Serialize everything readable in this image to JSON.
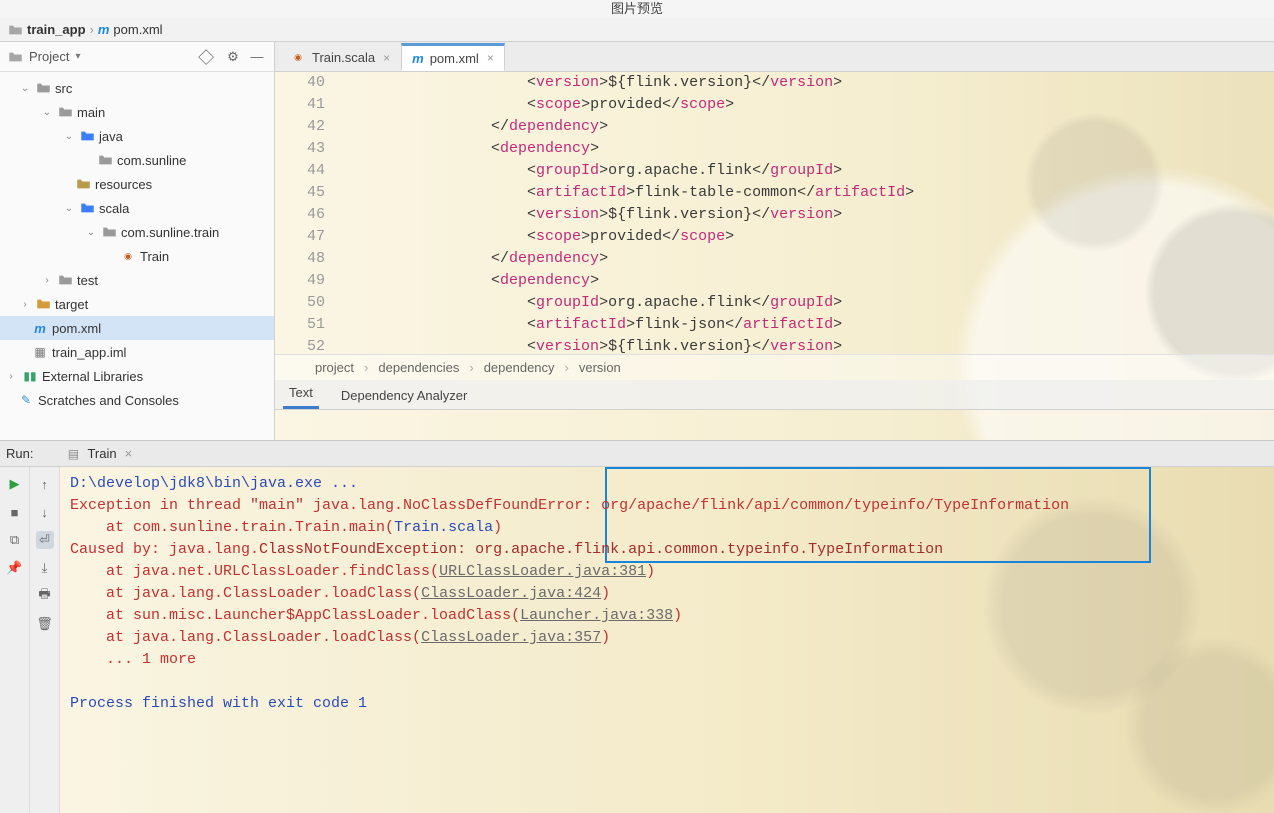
{
  "titlebar": "图片预览",
  "breadcrumb": {
    "seg1": "train_app",
    "seg2": "pom.xml"
  },
  "project": {
    "label": "Project",
    "tree": {
      "src": "src",
      "main": "main",
      "java": "java",
      "com_sunline": "com.sunline",
      "resources": "resources",
      "scala": "scala",
      "com_sunline_train": "com.sunline.train",
      "train": "Train",
      "test": "test",
      "target": "target",
      "pom": "pom.xml",
      "iml": "train_app.iml",
      "ext_lib": "External Libraries",
      "scratch": "Scratches and Consoles"
    }
  },
  "tabs": {
    "t1": "Train.scala",
    "t2": "pom.xml"
  },
  "code": {
    "lines": [
      "40",
      "41",
      "42",
      "43",
      "44",
      "45",
      "46",
      "47",
      "48",
      "49",
      "50",
      "51",
      "52"
    ],
    "l40": "            <version>${flink.version}</version>",
    "l41": "            <scope>provided</scope>",
    "l42": "        </dependency>",
    "l43": "        <dependency>",
    "l44": "            <groupId>org.apache.flink</groupId>",
    "l45": "            <artifactId>flink-table-common</artifactId>",
    "l46": "            <version>${flink.version}</version>",
    "l47": "            <scope>provided</scope>",
    "l48": "        </dependency>",
    "l49": "        <dependency>",
    "l50": "            <groupId>org.apache.flink</groupId>",
    "l51": "            <artifactId>flink-json</artifactId>",
    "l52": "            <version>${flink.version}</version>"
  },
  "xml_breadcrumb": {
    "b1": "project",
    "b2": "dependencies",
    "b3": "dependency",
    "b4": "version"
  },
  "subtabs": {
    "text": "Text",
    "analyzer": "Dependency Analyzer"
  },
  "run": {
    "label": "Run:",
    "config": "Train",
    "console": {
      "l1": "D:\\develop\\jdk8\\bin\\java.exe ...",
      "l2a": "Exception in thread \"main\" java.lang.NoClassDefFoundError: ",
      "l2b": "org/apache/flink/api/common/typeinfo/TypeInformation",
      "l3a": "    at com.sunline.train.Train.main(",
      "l3b": "Train.scala",
      "l3c": ")",
      "l4a": "Caused by: java.lang.",
      "l4b": "ClassNotFoundException: org.apache.flink.api.common.typeinfo.TypeInformation",
      "l5a": "    at java.net.URLClassLoader.findClass(",
      "l5b": "URLClassLoader.java:381",
      "l5c": ")",
      "l6a": "    at java.lang.ClassLoader.loadClass(",
      "l6b": "ClassLoader.java:424",
      "l6c": ")",
      "l7a": "    at sun.misc.Launcher$AppClassLoader.loadClass(",
      "l7b": "Launcher.java:338",
      "l7c": ")",
      "l8a": "    at java.lang.ClassLoader.loadClass(",
      "l8b": "ClassLoader.java:357",
      "l8c": ")",
      "l9": "    ... 1 more",
      "blank": "",
      "l10": "Process finished with exit code 1"
    }
  }
}
